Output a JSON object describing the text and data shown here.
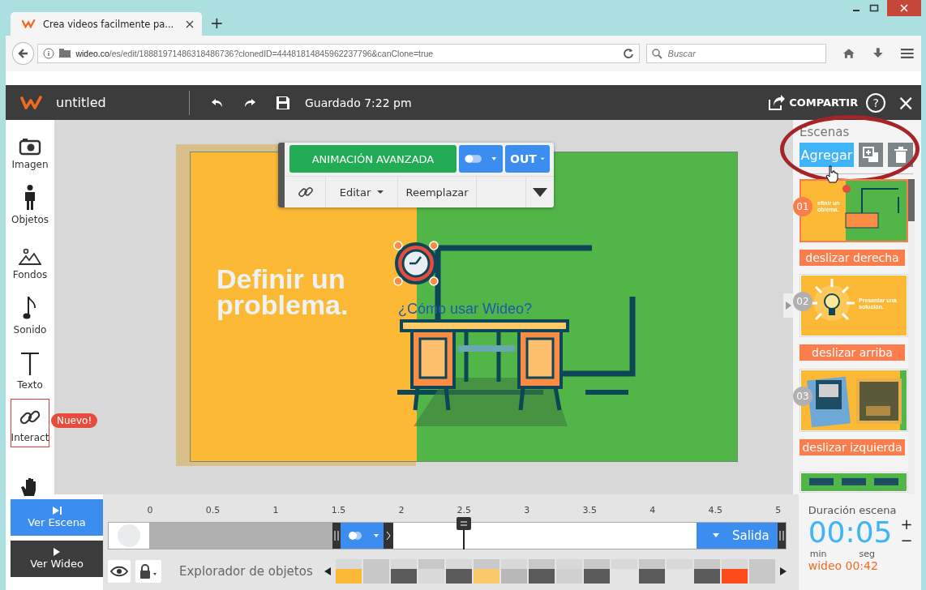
{
  "browser": {
    "tab_title": "Crea videos facilmente pa...",
    "new_tab": "+",
    "url_host": "wideo.co",
    "url_path": "/es/edit/18881971486318486736?clonedID=44481814845962237796&canClone=true",
    "search_placeholder": "Buscar"
  },
  "header": {
    "title": "untitled",
    "saved": "Guardado 7:22 pm",
    "share": "COMPARTIR",
    "help": "?",
    "close": "×"
  },
  "tools": [
    {
      "label": "Imagen",
      "kind": "camera",
      "selected": false
    },
    {
      "label": "Objetos",
      "kind": "person",
      "selected": false
    },
    {
      "label": "Fondos",
      "kind": "mountain",
      "selected": false
    },
    {
      "label": "Sonido",
      "kind": "note",
      "selected": false
    },
    {
      "label": "Texto",
      "kind": "text",
      "selected": false
    },
    {
      "label": "Interact",
      "kind": "link",
      "selected": true,
      "badge": "Nuevo!"
    },
    {
      "kind": "hand",
      "selected": false
    }
  ],
  "popup": {
    "animation": "ANIMACIÓN AVANZADA",
    "out": "OUT",
    "edit": "Editar",
    "replace": "Reemplazar"
  },
  "canvas": {
    "headline": "Definir un problema.",
    "link": "¿Cómo usar Wideo?"
  },
  "scenes": {
    "title": "Escenas",
    "add": "Agregar",
    "items": [
      {
        "number": "01",
        "selected": true,
        "kind": "desk",
        "caption": [
          "efinir un",
          "oblema."
        ],
        "transition": "deslizar derecha"
      },
      {
        "number": "02",
        "selected": false,
        "kind": "bulb",
        "caption": [
          "Presentar una",
          "solución."
        ],
        "transition": "deslizar arriba"
      },
      {
        "number": "03",
        "selected": false,
        "transition": "deslizar izquierda"
      },
      {
        "selected": false,
        "kind": "boards"
      }
    ]
  },
  "playback": {
    "scene": "Ver Escena",
    "video": "Ver Wideo"
  },
  "timeline": {
    "ticks": [
      "0",
      "0.5",
      "1",
      "1.5",
      "2",
      "2.5",
      "3",
      "3.5",
      "4",
      "4.5",
      "5"
    ],
    "exit": "Salida",
    "playhead": {
      "level": 0.5
    },
    "explorer": "Explorador de objetos"
  },
  "duration": {
    "title": "Duración escena",
    "time": "00:05",
    "min": "min",
    "sec": "seg",
    "plus": "+",
    "minus": "−",
    "total": "wideo 00:42"
  }
}
